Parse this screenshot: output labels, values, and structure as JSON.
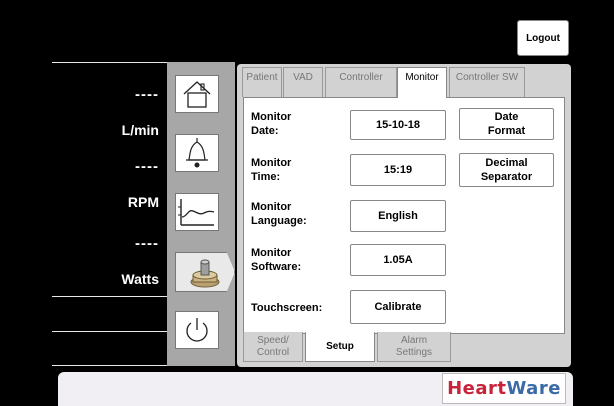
{
  "header": {
    "logout_label": "Logout"
  },
  "readouts": [
    {
      "value": "----",
      "unit": "L/min"
    },
    {
      "value": "----",
      "unit": "RPM"
    },
    {
      "value": "----",
      "unit": "Watts"
    }
  ],
  "nav": [
    {
      "name": "home",
      "icon": "home-icon"
    },
    {
      "name": "alarms",
      "icon": "bell-icon"
    },
    {
      "name": "trends",
      "icon": "trend-chart-icon"
    },
    {
      "name": "setup",
      "icon": "pump-icon",
      "active": true
    },
    {
      "name": "power",
      "icon": "power-icon"
    }
  ],
  "top_tabs": [
    "Patient",
    "VAD",
    "Controller",
    "Monitor",
    "Controller SW"
  ],
  "active_top_tab": "Monitor",
  "rows": {
    "date": {
      "label_line1": "Monitor",
      "label_line2": "Date:",
      "value": "15-10-18"
    },
    "time": {
      "label_line1": "Monitor",
      "label_line2": "Time:",
      "value": "15:19"
    },
    "language": {
      "label_line1": "Monitor",
      "label_line2": "Language:",
      "value": "English"
    },
    "software": {
      "label_line1": "Monitor",
      "label_line2": "Software:",
      "value": "1.05A"
    },
    "touchscreen": {
      "label": "Touchscreen:",
      "value": "Calibrate"
    }
  },
  "format_buttons": {
    "date_format": {
      "line1": "Date",
      "line2": "Format"
    },
    "decimal_separator": {
      "line1": "Decimal",
      "line2": "Separator"
    }
  },
  "bottom_tabs": {
    "speed_control": {
      "line1": "Speed/",
      "line2": "Control"
    },
    "setup": {
      "label": "Setup"
    },
    "alarm_settings": {
      "line1": "Alarm",
      "line2": "Settings"
    }
  },
  "active_bottom_tab": "Setup",
  "brand": {
    "part1": "Heart",
    "part2": "Ware",
    "color1": "#c8233a",
    "color2": "#3b6aa6"
  }
}
